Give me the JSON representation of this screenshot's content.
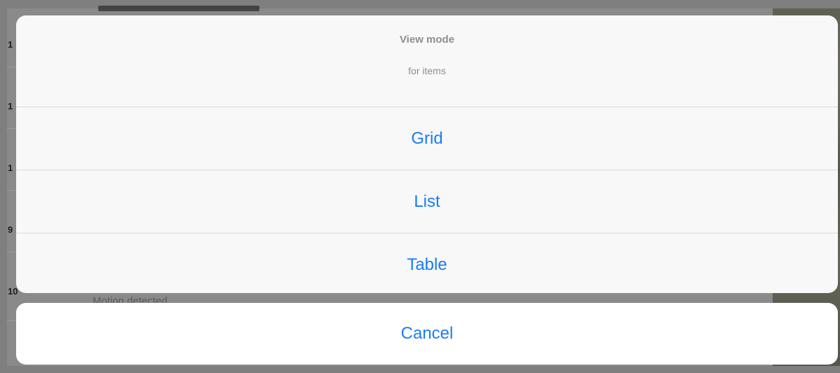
{
  "background": {
    "row_numbers": [
      "1",
      "1",
      "1",
      "9",
      "10"
    ],
    "peek_subtitle": "Motion detected"
  },
  "action_sheet": {
    "title": "View mode",
    "message": "for items",
    "options": [
      {
        "label": "Grid"
      },
      {
        "label": "List"
      },
      {
        "label": "Table"
      }
    ],
    "cancel_label": "Cancel",
    "accent_color": "#1a7cf6"
  }
}
